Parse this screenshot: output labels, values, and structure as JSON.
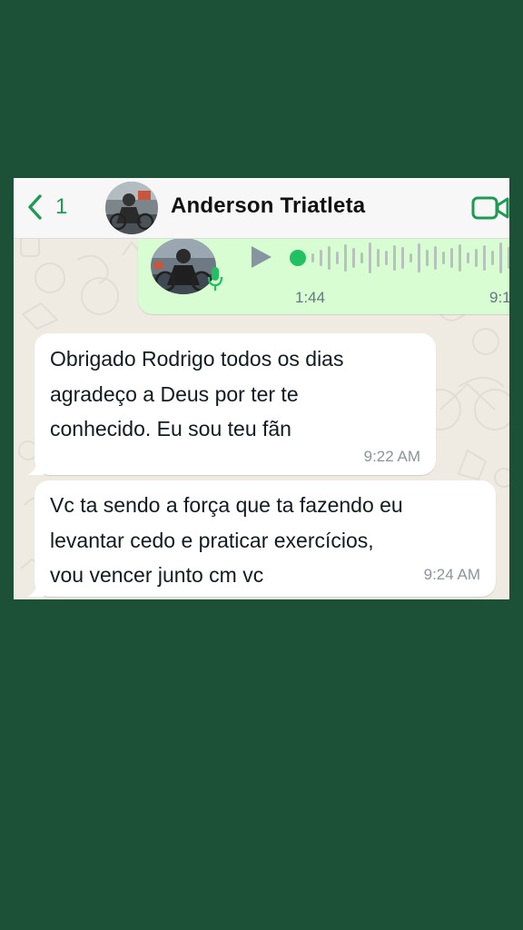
{
  "header": {
    "back_count": "1",
    "contact_name": "Anderson Triatleta"
  },
  "icons": {
    "back": "chevron-left-icon",
    "video_call": "video-camera-icon",
    "play": "play-icon",
    "microphone": "microphone-icon"
  },
  "colors": {
    "page_background": "#1d5137",
    "chat_background": "#efeae2",
    "accent_green": "#1f9a55",
    "outgoing_bubble": "#d9fdd3",
    "incoming_bubble": "#ffffff",
    "timestamp": "#8a959b"
  },
  "voice_message": {
    "duration": "1:44",
    "time": "9:1"
  },
  "messages": [
    {
      "lines": [
        "Obrigado Rodrigo todos os dias",
        "agradeço a Deus por ter te",
        "conhecido. Eu sou teu fãn"
      ],
      "time": "9:22 AM"
    },
    {
      "lines": [
        "Vc ta sendo a força que ta fazendo eu",
        "levantar cedo e praticar exercícios,",
        "vou vencer junto cm vc"
      ],
      "time": "9:24 AM"
    }
  ]
}
